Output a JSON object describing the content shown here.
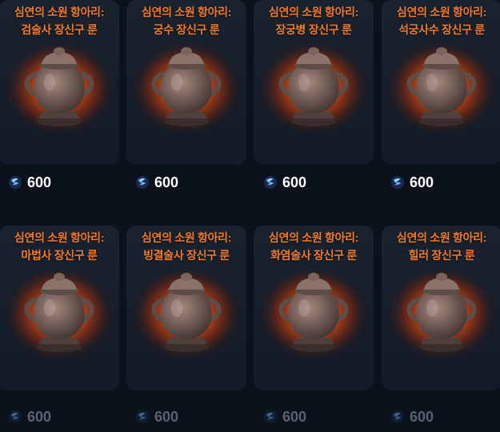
{
  "items": [
    {
      "title_line1": "심연의 소원 항아리:",
      "title_line2": "검술사 장신구 룬",
      "icon": "jar-icon",
      "currency_icon": "dragon-gem-icon",
      "price": "600",
      "available": true
    },
    {
      "title_line1": "심연의 소원 항아리:",
      "title_line2": "궁수 장신구 룬",
      "icon": "jar-icon",
      "currency_icon": "dragon-gem-icon",
      "price": "600",
      "available": true
    },
    {
      "title_line1": "심연의 소원 항아리:",
      "title_line2": "장궁병 장신구 룬",
      "icon": "jar-icon",
      "currency_icon": "dragon-gem-icon",
      "price": "600",
      "available": true
    },
    {
      "title_line1": "심연의 소원 항아리:",
      "title_line2": "석궁사수 장신구 룬",
      "icon": "jar-icon",
      "currency_icon": "dragon-gem-icon",
      "price": "600",
      "available": true
    },
    {
      "title_line1": "심연의 소원 항아리:",
      "title_line2": "마법사 장신구 룬",
      "icon": "jar-icon",
      "currency_icon": "dragon-gem-icon",
      "price": "600",
      "available": false
    },
    {
      "title_line1": "심연의 소원 항아리:",
      "title_line2": "빙결술사 장신구 룬",
      "icon": "jar-icon",
      "currency_icon": "dragon-gem-icon",
      "price": "600",
      "available": false
    },
    {
      "title_line1": "심연의 소원 항아리:",
      "title_line2": "화염술사 장신구 룬",
      "icon": "jar-icon",
      "currency_icon": "dragon-gem-icon",
      "price": "600",
      "available": false
    },
    {
      "title_line1": "심연의 소원 항아리:",
      "title_line2": "힐러 장신구 룬",
      "icon": "jar-icon",
      "currency_icon": "dragon-gem-icon",
      "price": "600",
      "available": false
    }
  ],
  "colors": {
    "title": "#f07a2a",
    "glow": "#ff5a10",
    "card_bg": "#161d28",
    "price_active": "#ffffff",
    "price_inactive": "#5a6270"
  }
}
